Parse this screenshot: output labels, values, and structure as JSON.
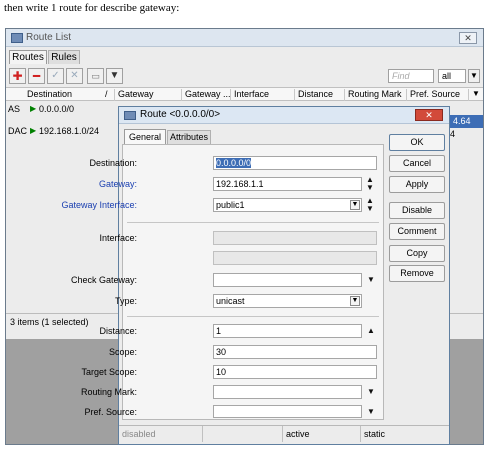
{
  "caption": "then write 1 route for describe gateway:",
  "route_list": {
    "title": "Route List",
    "tabs": [
      "Routes",
      "Rules"
    ],
    "find_placeholder": "Find",
    "filter_value": "all",
    "columns": [
      "Destination",
      "/",
      "Gateway",
      "Gateway ...",
      "Interface",
      "Distance",
      "Routing Mark",
      "Pref. Source"
    ],
    "rows": [
      {
        "flags": "AS",
        "destination": "0.0.0.0/0"
      },
      {
        "flags": "DAC",
        "destination": "192.168.1.0/24"
      }
    ],
    "pref_source_partial": [
      "4.64",
      "4"
    ],
    "status": "3 items (1 selected)"
  },
  "route_dialog": {
    "title": "Route <0.0.0.0/0>",
    "tabs": [
      "General",
      "Attributes"
    ],
    "labels": {
      "destination": "Destination:",
      "gateway": "Gateway:",
      "gateway_interface": "Gateway Interface:",
      "interface": "Interface:",
      "check_gateway": "Check Gateway:",
      "type": "Type:",
      "distance": "Distance:",
      "scope": "Scope:",
      "target_scope": "Target Scope:",
      "routing_mark": "Routing Mark:",
      "pref_source": "Pref. Source:"
    },
    "values": {
      "destination": "0.0.0.0/0",
      "gateway": "192.168.1.1",
      "gateway_interface": "public1",
      "type": "unicast",
      "distance": "1",
      "scope": "30",
      "target_scope": "10"
    },
    "buttons": [
      "OK",
      "Cancel",
      "Apply",
      "Disable",
      "Comment",
      "Copy",
      "Remove"
    ],
    "status": [
      "disabled",
      "",
      "active",
      "static"
    ]
  }
}
